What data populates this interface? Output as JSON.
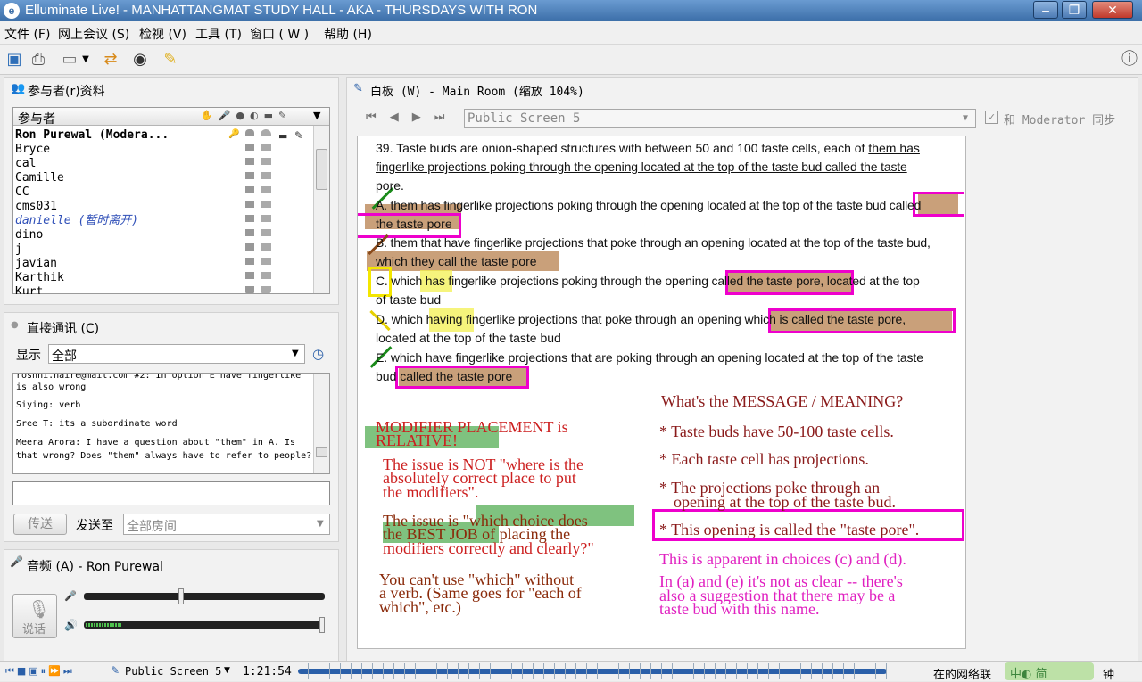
{
  "window": {
    "title": "Elluminate Live! - MANHATTANGMAT STUDY HALL - AKA - THURSDAYS WITH RON",
    "min": "‒",
    "max": "❐",
    "close": "✕"
  },
  "menu": [
    "文件 (F)",
    "网上会议 (S)",
    "检视 (V)",
    "工具 (T)",
    "窗口 ( W )",
    "帮助 (H)"
  ],
  "toolbar_icons": [
    "save-icon",
    "print-icon",
    "layout-icon",
    "dropdown-icon",
    "share-icon",
    "webcam-icon",
    "notes-icon",
    "info-icon"
  ],
  "participants": {
    "title": "参与者(r)资料",
    "column_header": "参与者",
    "list": [
      {
        "name": "Ron Purewal (Modera...",
        "style": "bold"
      },
      {
        "name": "Bryce"
      },
      {
        "name": "cal"
      },
      {
        "name": "Camille"
      },
      {
        "name": "CC"
      },
      {
        "name": "cms031"
      },
      {
        "name": "danielle (暂时离开)",
        "style": "away"
      },
      {
        "name": "dino"
      },
      {
        "name": "j"
      },
      {
        "name": "javian"
      },
      {
        "name": "Karthik"
      },
      {
        "name": "Kurt"
      }
    ]
  },
  "chat": {
    "title": "直接通讯 (C)",
    "show_label": "显示",
    "filter": "全部",
    "messages": [
      "roshni.naire@mail.com #2: In option E have fingerlike",
      "is also wrong",
      "Siying: verb",
      "Sree T: its a subordinate word",
      "Meera Arora: I have a question about \"them\" in A. Is",
      "that wrong? Does \"them\" always have to refer to people?"
    ],
    "input_value": "",
    "send_label": "传送",
    "send_to_label": "发送至",
    "send_to_value": "全部房间"
  },
  "audio": {
    "title": "音频 (A) - Ron Purewal",
    "talk_label": "说话",
    "mic_level": 0.4,
    "speaker_level": 1.0
  },
  "whiteboard": {
    "title": "白板 (W) - Main Room (缩放 104%)",
    "screen": "Public Screen 5",
    "sync_label": "和 Moderator 同步",
    "sync_checked": true,
    "question": {
      "stem_1": "39. Taste buds are onion-shaped structures with between 50 and 100 taste cells, each of",
      "stem_underlined": "them has",
      "stem_2": "fingerlike projections poking through the opening located at the top of the taste bud called the taste",
      "stem_3": "pore.",
      "a_1": "A. them has fingerlike projections poking through the opening located at the top of the taste bud called",
      "a_2": "the taste pore",
      "b_1": "B. them that have fingerlike projections that poke through an opening located at the top of the taste bud,",
      "b_2": "which they call the taste pore",
      "c_1": "C. which has fingerlike projections poking through the opening called the taste pore, located at the top",
      "c_2": "of taste bud",
      "d_1": "D. which having fingerlike projections that poke through an opening which is called the taste pore,",
      "d_2": "located at the top of the taste bud",
      "e_1": "E. which have fingerlike projections that are poking through an opening located at the top of the taste",
      "e_2": "bud called the taste pore"
    },
    "notes_left": [
      "MODIFIER PLACEMENT is",
      "RELATIVE!",
      "The issue is NOT \"where is the",
      "absolutely correct place to put",
      "the modifiers\".",
      "The issue is \"which choice does",
      "the BEST JOB of placing the",
      "modifiers correctly and clearly?\"",
      "You can't use \"which\" without",
      "a verb.  (Same goes for \"each of",
      "which\", etc.)"
    ],
    "notes_right": [
      "What's the MESSAGE / MEANING?",
      "* Taste buds have 50-100 taste cells.",
      "* Each taste cell has projections.",
      "* The projections poke through an",
      "opening at the top of the taste bud.",
      "* This opening is called the \"taste pore\".",
      "This is apparent in choices (c) and (d).",
      "In (a) and (e) it's not as clear -- there's",
      "also a suggestion that there may be a",
      "taste bud with this name."
    ],
    "colors": {
      "magenta": "#ee00cc",
      "tan": "#c9a07a",
      "green_hl": "#7fc27f",
      "yellow_hl": "#f3f050",
      "red_ink": "#cc1f1f",
      "brown_ink": "#8a2a0a"
    }
  },
  "status": {
    "screen": "Public Screen 5",
    "time": "1:21:54",
    "right_text": "在的网络联",
    "right_text_2": "钟",
    "ime": "中◐ 简"
  }
}
